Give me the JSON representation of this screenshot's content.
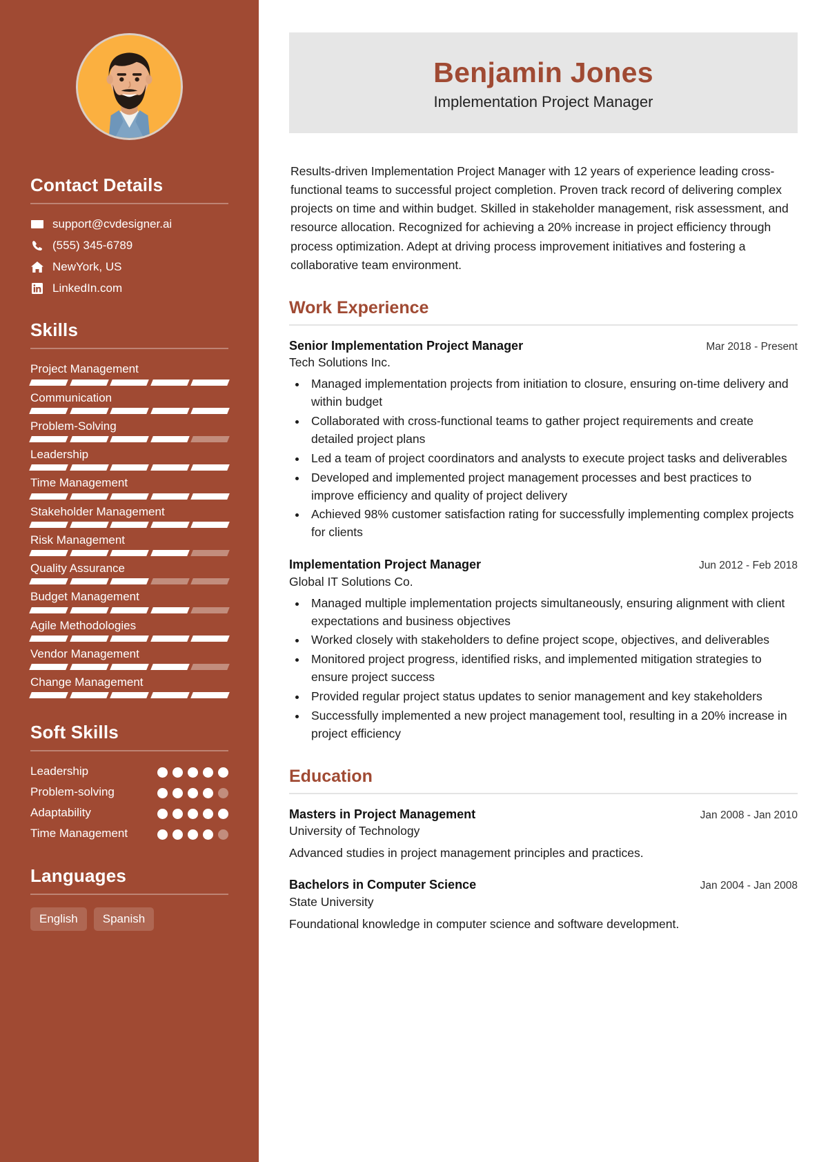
{
  "theme": {
    "sidebar_bg": "#a04a33",
    "accent": "#a04a33",
    "banner_bg": "#e6e6e6",
    "avatar_bg": "#fbb040",
    "bar_empty": "#c28d7d",
    "bar_fill": "#ffffff"
  },
  "header": {
    "name": "Benjamin Jones",
    "job_title": "Implementation Project Manager"
  },
  "summary": "Results-driven Implementation Project Manager with 12 years of experience leading cross-functional teams to successful project completion. Proven track record of delivering complex projects on time and within budget. Skilled in stakeholder management, risk assessment, and resource allocation. Recognized for achieving a 20% increase in project efficiency through process optimization. Adept at driving process improvement initiatives and fostering a collaborative team environment.",
  "sidebar": {
    "contact": {
      "heading": "Contact Details",
      "items": [
        {
          "icon": "envelope-icon",
          "value": "support@cvdesigner.ai"
        },
        {
          "icon": "phone-icon",
          "value": "(555) 345-6789"
        },
        {
          "icon": "home-icon",
          "value": "NewYork, US"
        },
        {
          "icon": "linkedin-icon",
          "value": "LinkedIn.com"
        }
      ]
    },
    "skills": {
      "heading": "Skills",
      "max": 5,
      "items": [
        {
          "name": "Project Management",
          "level": 5
        },
        {
          "name": "Communication",
          "level": 5
        },
        {
          "name": "Problem-Solving",
          "level": 4
        },
        {
          "name": "Leadership",
          "level": 5
        },
        {
          "name": "Time Management",
          "level": 5
        },
        {
          "name": "Stakeholder Management",
          "level": 5
        },
        {
          "name": "Risk Management",
          "level": 4
        },
        {
          "name": "Quality Assurance",
          "level": 3
        },
        {
          "name": "Budget Management",
          "level": 4
        },
        {
          "name": "Agile Methodologies",
          "level": 5
        },
        {
          "name": "Vendor Management",
          "level": 4
        },
        {
          "name": "Change Management",
          "level": 5
        }
      ]
    },
    "soft_skills": {
      "heading": "Soft Skills",
      "max": 5,
      "items": [
        {
          "name": "Leadership",
          "level": 5
        },
        {
          "name": "Problem-solving",
          "level": 4
        },
        {
          "name": "Adaptability",
          "level": 5
        },
        {
          "name": "Time Management",
          "level": 4
        }
      ]
    },
    "languages": {
      "heading": "Languages",
      "items": [
        "English",
        "Spanish"
      ]
    }
  },
  "work": {
    "heading": "Work Experience",
    "entries": [
      {
        "role": "Senior Implementation Project Manager",
        "date": "Mar 2018 - Present",
        "org": "Tech Solutions Inc.",
        "bullets": [
          "Managed implementation projects from initiation to closure, ensuring on-time delivery and within budget",
          "Collaborated with cross-functional teams to gather project requirements and create detailed project plans",
          "Led a team of project coordinators and analysts to execute project tasks and deliverables",
          "Developed and implemented project management processes and best practices to improve efficiency and quality of project delivery",
          "Achieved 98% customer satisfaction rating for successfully implementing complex projects for clients"
        ]
      },
      {
        "role": "Implementation Project Manager",
        "date": "Jun 2012 - Feb 2018",
        "org": "Global IT Solutions Co.",
        "bullets": [
          "Managed multiple implementation projects simultaneously, ensuring alignment with client expectations and business objectives",
          "Worked closely with stakeholders to define project scope, objectives, and deliverables",
          "Monitored project progress, identified risks, and implemented mitigation strategies to ensure project success",
          "Provided regular project status updates to senior management and key stakeholders",
          "Successfully implemented a new project management tool, resulting in a 20% increase in project efficiency"
        ]
      }
    ]
  },
  "education": {
    "heading": "Education",
    "entries": [
      {
        "degree": "Masters in Project Management",
        "date": "Jan 2008 - Jan 2010",
        "school": "University of Technology",
        "desc": "Advanced studies in project management principles and practices."
      },
      {
        "degree": "Bachelors in Computer Science",
        "date": "Jan 2004 - Jan 2008",
        "school": "State University",
        "desc": "Foundational knowledge in computer science and software development."
      }
    ]
  }
}
